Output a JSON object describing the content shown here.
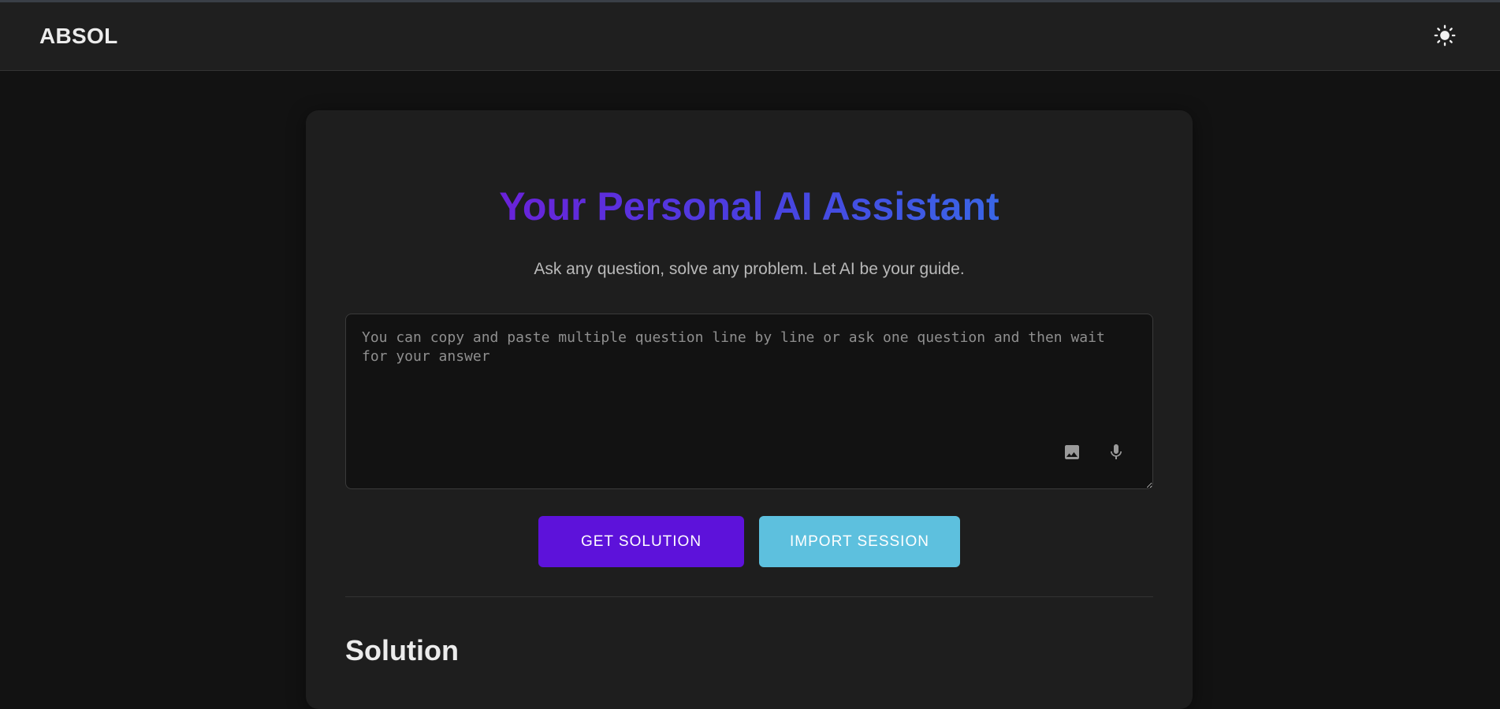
{
  "app": {
    "brand": "ABSOL"
  },
  "header": {
    "theme_toggle_icon": "sun-icon"
  },
  "hero": {
    "title": "Your Personal AI Assistant",
    "subtitle": "Ask any question, solve any problem. Let AI be your guide."
  },
  "question_input": {
    "value": "",
    "placeholder": "You can copy and paste multiple question line by line or ask one question and then wait for your answer",
    "image_icon": "image-icon",
    "mic_icon": "microphone-icon"
  },
  "actions": {
    "get_solution": "GET SOLUTION",
    "import_session": "IMPORT SESSION"
  },
  "solution": {
    "heading": "Solution"
  },
  "colors": {
    "background": "#121212",
    "card": "#1e1e1e",
    "primary_button": "#5d12da",
    "secondary_button": "#5dc0de",
    "title_gradient_start": "#6a22d9",
    "title_gradient_end": "#3a66e6"
  }
}
